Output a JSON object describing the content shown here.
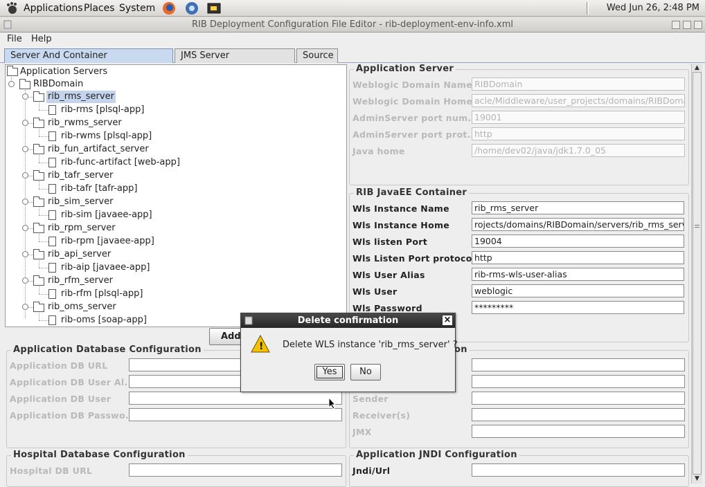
{
  "panel": {
    "menus": [
      "Applications",
      "Places",
      "System"
    ],
    "clock": "Wed Jun 26,  2:48 PM"
  },
  "window": {
    "title": "RIB Deployment Configuration File Editor - rib-deployment-env-info.xml"
  },
  "menubar": {
    "file": "File",
    "help": "Help"
  },
  "tabs": [
    {
      "label": "Server And Container Configuration",
      "active": true
    },
    {
      "label": "JMS Server Configuration",
      "active": false
    },
    {
      "label": "Source",
      "active": false
    }
  ],
  "tree": {
    "root": "Application Servers",
    "domain": "RIBDomain",
    "servers": [
      {
        "name": "rib_rms_server",
        "app": "rib-rms  [plsql-app]",
        "selected": true
      },
      {
        "name": "rib_rwms_server",
        "app": "rib-rwms  [plsql-app]"
      },
      {
        "name": "rib_fun_artifact_server",
        "app": "rib-func-artifact  [web-app]"
      },
      {
        "name": "rib_tafr_server",
        "app": "rib-tafr  [tafr-app]"
      },
      {
        "name": "rib_sim_server",
        "app": "rib-sim  [javaee-app]"
      },
      {
        "name": "rib_rpm_server",
        "app": "rib-rpm  [javaee-app]"
      },
      {
        "name": "rib_api_server",
        "app": "rib-aip  [javaee-app]"
      },
      {
        "name": "rib_rfm_server",
        "app": "rib-rfm  [plsql-app]"
      },
      {
        "name": "rib_oms_server",
        "app": "rib-oms  [soap-app]"
      }
    ]
  },
  "add_button": "Add",
  "app_server": {
    "title": "Application Server",
    "fields": [
      {
        "label": "Weblogic Domain Name",
        "value": "RIBDomain"
      },
      {
        "label": "Weblogic Domain Home",
        "value": "acle/Middleware/user_projects/domains/RIBDomain"
      },
      {
        "label": "AdminServer port num...",
        "value": "19001"
      },
      {
        "label": "AdminServer port prot...",
        "value": "http"
      },
      {
        "label": "Java home",
        "value": "/home/dev02/java/jdk1.7.0_05"
      }
    ]
  },
  "container": {
    "title": "RIB JavaEE Container",
    "fields": [
      {
        "label": "Wls Instance Name",
        "value": "rib_rms_server"
      },
      {
        "label": "Wls Instance Home",
        "value": "rojects/domains/RIBDomain/servers/rib_rms_server"
      },
      {
        "label": "Wls listen Port",
        "value": "19004"
      },
      {
        "label": "Wls Listen Port protocol",
        "value": "http"
      },
      {
        "label": "Wls User Alias",
        "value": "rib-rms-wls-user-alias"
      },
      {
        "label": "Wls User",
        "value": "weblogic"
      },
      {
        "label": "Wls Password",
        "value": "*********"
      }
    ]
  },
  "app_db": {
    "title": "Application Database Configuration",
    "fields": [
      {
        "label": "Application DB URL",
        "value": ""
      },
      {
        "label": "Application DB User Al...",
        "value": ""
      },
      {
        "label": "Application DB User",
        "value": ""
      },
      {
        "label": "Application DB Passwo...",
        "value": ""
      }
    ]
  },
  "notification": {
    "title_tail": "on",
    "labels": [
      "Sender",
      "Receiver(s)",
      "JMX"
    ]
  },
  "hospital_db": {
    "title": "Hospital Database Configuration",
    "fields": [
      {
        "label": "Hospital DB URL",
        "value": ""
      }
    ]
  },
  "jndi": {
    "title": "Application JNDI Configuration",
    "fields": [
      {
        "label": "Jndi/Url",
        "value": ""
      }
    ]
  },
  "dialog": {
    "title": "Delete confirmation",
    "message": "Delete WLS instance 'rib_rms_server' ?",
    "yes": "Yes",
    "no": "No",
    "close": "×",
    "warning_mark": "!"
  },
  "colors": {
    "selection": "#c4d4ec",
    "active_tab": "#c9d9f0",
    "dialog_title": "#2f2f2f",
    "warning": "#f2c200"
  }
}
